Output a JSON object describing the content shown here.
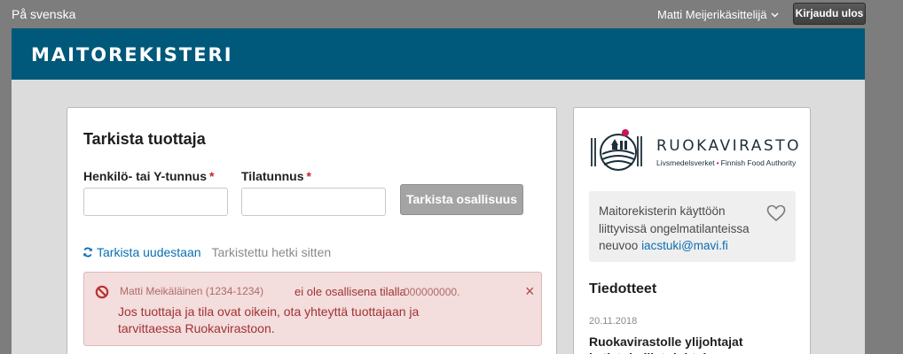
{
  "topbar": {
    "language_link": "På svenska",
    "user_name": "Matti Meijerikäsittelijä",
    "logout_label": "Kirjaudu ulos"
  },
  "header": {
    "app_title": "MAITOREKISTERI"
  },
  "check_form": {
    "title": "Tarkista tuottaja",
    "id_label": "Henkilö- tai Y-tunnus",
    "farm_label": "Tilatunnus",
    "required_mark": "*",
    "id_value": "",
    "farm_value": "",
    "submit_label": "Tarkista osallisuus",
    "refresh_label": "Tarkista uudestaan",
    "checked_status": "Tarkistettu hetki sitten"
  },
  "alert": {
    "producer": "Matti Meikäläinen (1234-1234)",
    "message_part1": "ei ole osallisena tilalla",
    "farm_id": "000000000.",
    "message_part2": "Jos tuottaja ja tila ovat oikein, ota yhteyttä tuottajaan ja tarvittaessa Ruokavirastoon.",
    "close_symbol": "×"
  },
  "sidebar": {
    "logo_word": "RUOKAVIRASTO",
    "logo_sub_left": "Livsmedelsverket",
    "logo_sub_dot": "•",
    "logo_sub_right": "Finnish Food Authority",
    "support_text": "Maitorekisterin käyttöön liittyvissä ongelmatilanteissa neuvoo",
    "support_email": "iacstuki@mavi.fi",
    "news_title": "Tiedotteet",
    "news_date": "20.11.2018",
    "news_headline": "Ruokavirastolle ylijohtajat ja tietohallintojohtaja"
  },
  "colors": {
    "header_bg": "#00587a",
    "alert_bg": "#f3dddd",
    "alert_text": "#a23232",
    "link": "#0a6fb0",
    "brand_accent": "#c8155c"
  },
  "icons": [
    "chevron-down-icon",
    "refresh-icon",
    "prohibited-icon",
    "close-icon",
    "heart-icon",
    "ruokavirasto-logo"
  ]
}
